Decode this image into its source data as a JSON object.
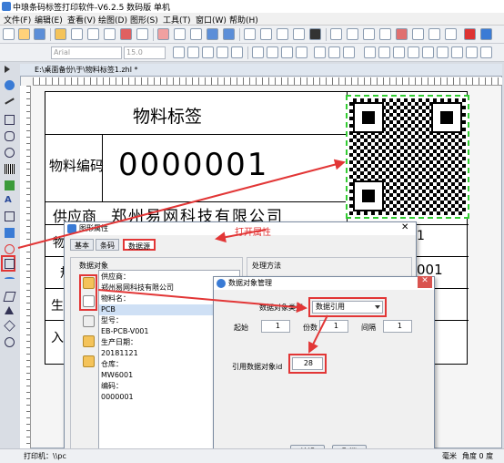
{
  "window": {
    "title": "中琅条码标签打印软件-V6.2.5 数码版 单机"
  },
  "menu": [
    "文件(F)",
    "编辑(E)",
    "查看(V)",
    "绘图(D)",
    "图形(S)",
    "工具(T)",
    "窗口(W)",
    "帮助(H)"
  ],
  "font_toolbar": {
    "font": "Arial",
    "size": "15.0"
  },
  "document": {
    "tab_title": "E:\\桌面备份\\于\\物料标签1.zhl *"
  },
  "label": {
    "title": "物料标签",
    "code_label": "物料编码",
    "code_value": "0000001",
    "supplier_label": "供应商",
    "supplier_value": "郑州易网科技有限公司",
    "row_frag_1": "物",
    "row_frag_2": "规",
    "row_frag_3": "生",
    "row_frag_4": "入",
    "right_frag_1": "1",
    "right_frag_2": "001"
  },
  "annotation": {
    "open_props": "打开属性"
  },
  "dialog_props": {
    "title": "图形属性",
    "tabs": [
      "基本",
      "条码",
      "数据源"
    ],
    "data_objects_label": "数据对象",
    "processing_label": "处理方法",
    "items": [
      "供应商：",
      "郑州易网科技有限公司",
      "物料名：",
      "PCB",
      "型号：",
      "EB-PCB-V001",
      "生产日期：",
      "20181121",
      "仓库：",
      "MW6001",
      "编码：",
      "0000001"
    ]
  },
  "dialog_mgr": {
    "title": "数据对象管理",
    "type_label": "数据对象类型",
    "type_value": "数据引用",
    "start_label": "起始",
    "start_value": "1",
    "copies_label": "份数",
    "copies_value": "1",
    "interval_label": "间隔",
    "interval_value": "1",
    "ref_label": "引用数据对象id",
    "ref_value": "28",
    "edit_button": "编辑",
    "cancel_button": "取消"
  },
  "statusbar": {
    "printer": "打印机：\\\\pc",
    "dim": "毫米",
    "angle": "角度 0 度"
  }
}
